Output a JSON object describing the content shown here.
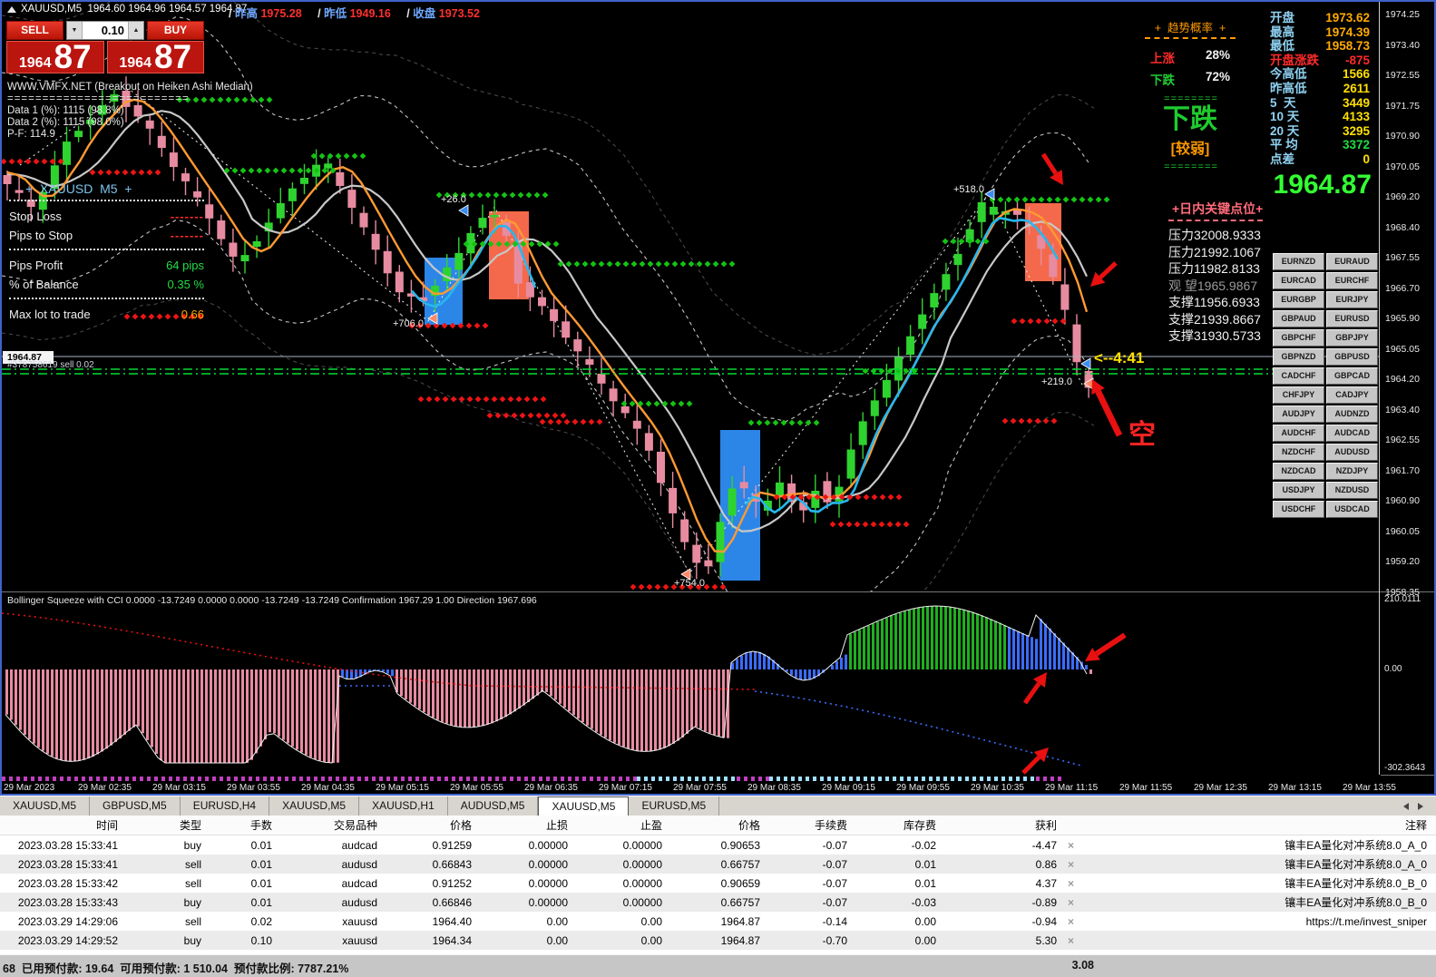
{
  "titlebar": {
    "symbol_title": "XAUUSD,M5  1964.60 1964.96 1964.57 1964.87",
    "prev_high_label": "昨高",
    "prev_high": "1975.28",
    "prev_low_label": "昨低",
    "prev_low": "1949.16",
    "close_label": "收盘",
    "close": "1973.52",
    "slash": "/"
  },
  "trade_widget": {
    "sell_label": "SELL",
    "buy_label": "BUY",
    "lot": "0.10",
    "spin_down": "▼",
    "spin_up": "▲",
    "sell_price_main": "1964",
    "sell_price_pips": "87",
    "buy_price_main": "1964",
    "buy_price_pips": "87"
  },
  "system_info": {
    "line1": "WWW.VMFX.NET (Breakout on Heiken Ashi Median)",
    "sep": "==========================",
    "data1": "Data 1 (%): 1115 (98.8%)",
    "data2": "Data 2 (%): 1115 (98.0%)",
    "pf": "P-F: 114.9"
  },
  "risk_panel": {
    "title": "+  XAUUSD  M5  +",
    "rows": [
      {
        "label": "Stop Loss",
        "value": "-------",
        "cls": "v-reddash"
      },
      {
        "label": "Pips to Stop",
        "value": "-------",
        "cls": "v-reddash"
      },
      {
        "label": "Pips Profit",
        "value": "64 pips",
        "cls": "v-green"
      },
      {
        "label": "% of Balance",
        "value": "0.35 %",
        "cls": "v-green"
      },
      {
        "label": "Max lot to trade",
        "value": "0.66",
        "cls": "v-orange"
      }
    ]
  },
  "trend_panel": {
    "title": "+  趋势概率  +",
    "up_label": "上涨",
    "up_value": "28%",
    "down_label": "下跌",
    "down_value": "72%",
    "sep": "= = = = = = = =",
    "signal": "下跌",
    "strength": "[较弱]"
  },
  "stats_panel": {
    "rows": [
      {
        "label": "开盘",
        "value": "1973.62",
        "lc": "lc-cyan",
        "vc": "vc-orange"
      },
      {
        "label": "最高",
        "value": "1974.39",
        "lc": "lc-cyan",
        "vc": "vc-orange"
      },
      {
        "label": "最低",
        "value": "1958.73",
        "lc": "lc-cyan",
        "vc": "vc-orange"
      },
      {
        "label": "开盘涨跌",
        "value": "-875",
        "lc": "lc-red",
        "vc": "vc-red"
      },
      {
        "label": "今高低",
        "value": "1566",
        "lc": "lc-cyan",
        "vc": "vc-yellow"
      },
      {
        "label": "昨高低",
        "value": "2611",
        "lc": "lc-cyan",
        "vc": "vc-yellow"
      },
      {
        "label": "5  天",
        "value": "3449",
        "lc": "lc-cyan",
        "vc": "vc-yellow"
      },
      {
        "label": "10 天",
        "value": "4133",
        "lc": "lc-cyan",
        "vc": "vc-yellow"
      },
      {
        "label": "20 天",
        "value": "3295",
        "lc": "lc-cyan",
        "vc": "vc-yellow"
      },
      {
        "label": "平 均",
        "value": "3372",
        "lc": "lc-cyan",
        "vc": "vc-green"
      },
      {
        "label": "点差",
        "value": "0",
        "lc": "lc-cyan",
        "vc": "vc-yellow"
      }
    ],
    "big_price": "1964.87"
  },
  "key_levels": {
    "title": "+日内关键点位+",
    "rows": [
      {
        "label": "压力3",
        "value": "2008.9333",
        "muted": false
      },
      {
        "label": "压力2",
        "value": "1992.1067",
        "muted": false
      },
      {
        "label": "压力1",
        "value": "1982.8133",
        "muted": false
      },
      {
        "label": "观 望",
        "value": "1965.9867",
        "muted": true
      },
      {
        "label": "支撑1",
        "value": "1956.6933",
        "muted": false
      },
      {
        "label": "支撑2",
        "value": "1939.8667",
        "muted": false
      },
      {
        "label": "支撑3",
        "value": "1930.5733",
        "muted": false
      }
    ]
  },
  "pair_grid": [
    [
      "EURNZD",
      "EURAUD"
    ],
    [
      "EURCAD",
      "EURCHF"
    ],
    [
      "EURGBP",
      "EURJPY"
    ],
    [
      "GBPAUD",
      "EURUSD"
    ],
    [
      "GBPCHF",
      "GBPJPY"
    ],
    [
      "GBPNZD",
      "GBPUSD"
    ],
    [
      "CADCHF",
      "GBPCAD"
    ],
    [
      "CHFJPY",
      "CADJPY"
    ],
    [
      "AUDJPY",
      "AUDNZD"
    ],
    [
      "AUDCHF",
      "AUDCAD"
    ],
    [
      "NZDCHF",
      "AUDUSD"
    ],
    [
      "NZDCAD",
      "NZDJPY"
    ],
    [
      "USDJPY",
      "NZDUSD"
    ],
    [
      "USDCHF",
      "USDCAD"
    ]
  ],
  "price_axis": {
    "labels": [
      "1974.25",
      "1973.40",
      "1972.55",
      "1971.75",
      "1970.90",
      "1970.05",
      "1969.20",
      "1968.40",
      "1967.55",
      "1966.70",
      "1965.90",
      "1965.05",
      "1964.20",
      "1963.40",
      "1962.55",
      "1961.70",
      "1960.90",
      "1960.05",
      "1959.20",
      "1958.35"
    ],
    "current": "1964.87"
  },
  "annotations": {
    "plus26": "+26.0",
    "plus706": "+706.0",
    "plus518": "+518.0",
    "plus219": "+219.0",
    "plus754": "+754.0",
    "countdown": "<--4:41",
    "short_label": "空",
    "order_line": "#378758619 sell 0.02"
  },
  "indicator_pane": {
    "title": "Bollinger Squeeze with CCI 0.0000 -13.7249 0.0000 0.0000 -13.7249 -13.7249  Confirmation 1967.29 1.00  Direction 1967.696",
    "axis_top": "210.0111",
    "axis_zero": "0.00",
    "axis_bottom": "-302.3643"
  },
  "time_axis": [
    "29 Mar 2023",
    "29 Mar 02:35",
    "29 Mar 03:15",
    "29 Mar 03:55",
    "29 Mar 04:35",
    "29 Mar 05:15",
    "29 Mar 05:55",
    "29 Mar 06:35",
    "29 Mar 07:15",
    "29 Mar 07:55",
    "29 Mar 08:35",
    "29 Mar 09:15",
    "29 Mar 09:55",
    "29 Mar 10:35",
    "29 Mar 11:15",
    "29 Mar 11:55",
    "29 Mar 12:35",
    "29 Mar 13:15",
    "29 Mar 13:55"
  ],
  "tabs": {
    "items": [
      "XAUUSD,M5",
      "GBPUSD,M5",
      "EURUSD,H4",
      "XAUUSD,M5",
      "XAUUSD,H1",
      "AUDUSD,M5",
      "XAUUSD,M5",
      "EURUSD,M5"
    ],
    "active_index": 6
  },
  "trade_table": {
    "headers": [
      "时间",
      "类型",
      "手数",
      "交易品种",
      "价格",
      "止损",
      "止盈",
      "价格",
      "手续费",
      "库存费",
      "获利",
      "注释"
    ],
    "close_icon": "×",
    "rows": [
      [
        "2023.03.28 15:33:41",
        "buy",
        "0.01",
        "audcad",
        "0.91259",
        "0.00000",
        "0.00000",
        "0.90653",
        "-0.07",
        "-0.02",
        "-4.47",
        "镶丰EA量化对冲系统8.0_A_0"
      ],
      [
        "2023.03.28 15:33:41",
        "sell",
        "0.01",
        "audusd",
        "0.66843",
        "0.00000",
        "0.00000",
        "0.66757",
        "-0.07",
        "0.01",
        "0.86",
        "镶丰EA量化对冲系统8.0_A_0"
      ],
      [
        "2023.03.28 15:33:42",
        "sell",
        "0.01",
        "audcad",
        "0.91252",
        "0.00000",
        "0.00000",
        "0.90659",
        "-0.07",
        "0.01",
        "4.37",
        "镶丰EA量化对冲系统8.0_B_0"
      ],
      [
        "2023.03.28 15:33:43",
        "buy",
        "0.01",
        "audusd",
        "0.66846",
        "0.00000",
        "0.00000",
        "0.66757",
        "-0.07",
        "-0.03",
        "-0.89",
        "镶丰EA量化对冲系统8.0_B_0"
      ],
      [
        "2023.03.29 14:29:06",
        "sell",
        "0.02",
        "xauusd",
        "1964.40",
        "0.00",
        "0.00",
        "1964.87",
        "-0.14",
        "0.00",
        "-0.94",
        "https://t.me/invest_sniper"
      ],
      [
        "2023.03.29 14:29:52",
        "buy",
        "0.10",
        "xauusd",
        "1964.34",
        "0.00",
        "0.00",
        "1964.87",
        "-0.70",
        "0.00",
        "5.30",
        ""
      ]
    ]
  },
  "status_bar": {
    "left": "68  已用预付款: 19.64  可用预付款: 1 510.04  预付款比例: 7787.21%",
    "profit_total": "3.08"
  }
}
